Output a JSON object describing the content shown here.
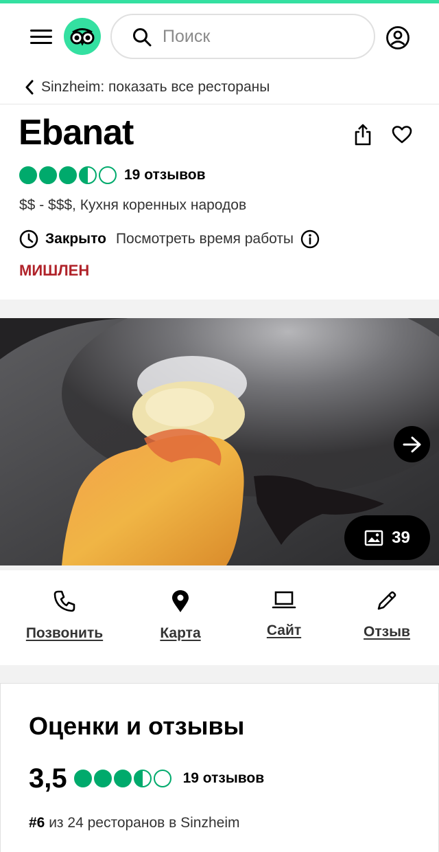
{
  "header": {
    "search_placeholder": "Поиск",
    "icons": [
      "hamburger-menu-icon",
      "tripadvisor-owl-logo",
      "search-icon",
      "account-icon"
    ],
    "accent_color": "#34e0a1"
  },
  "breadcrumb": {
    "text": "Sinzheim: показать все рестораны"
  },
  "restaurant": {
    "name": "Ebanat",
    "rating_bubbles": 3.5,
    "reviews_label": "19 отзывов",
    "price_cuisine": "$$ - $$$, Кухня коренных народов",
    "status": "Закрыто",
    "hours_link": "Посмотреть время работы",
    "badge": "МИШЛЕН",
    "badge_color": "#b0232a",
    "rating_color": "#00aa6c"
  },
  "gallery": {
    "photo_count": "39"
  },
  "actions": {
    "call": "Позвонить",
    "map": "Карта",
    "site": "Сайт",
    "review": "Отзыв"
  },
  "ratings_section": {
    "title": "Оценки и отзывы",
    "score": "3,5",
    "reviews_label": "19 отзывов",
    "rank_number": "#6",
    "rank_text": " из 24 ресторанов в Sinzheim"
  }
}
